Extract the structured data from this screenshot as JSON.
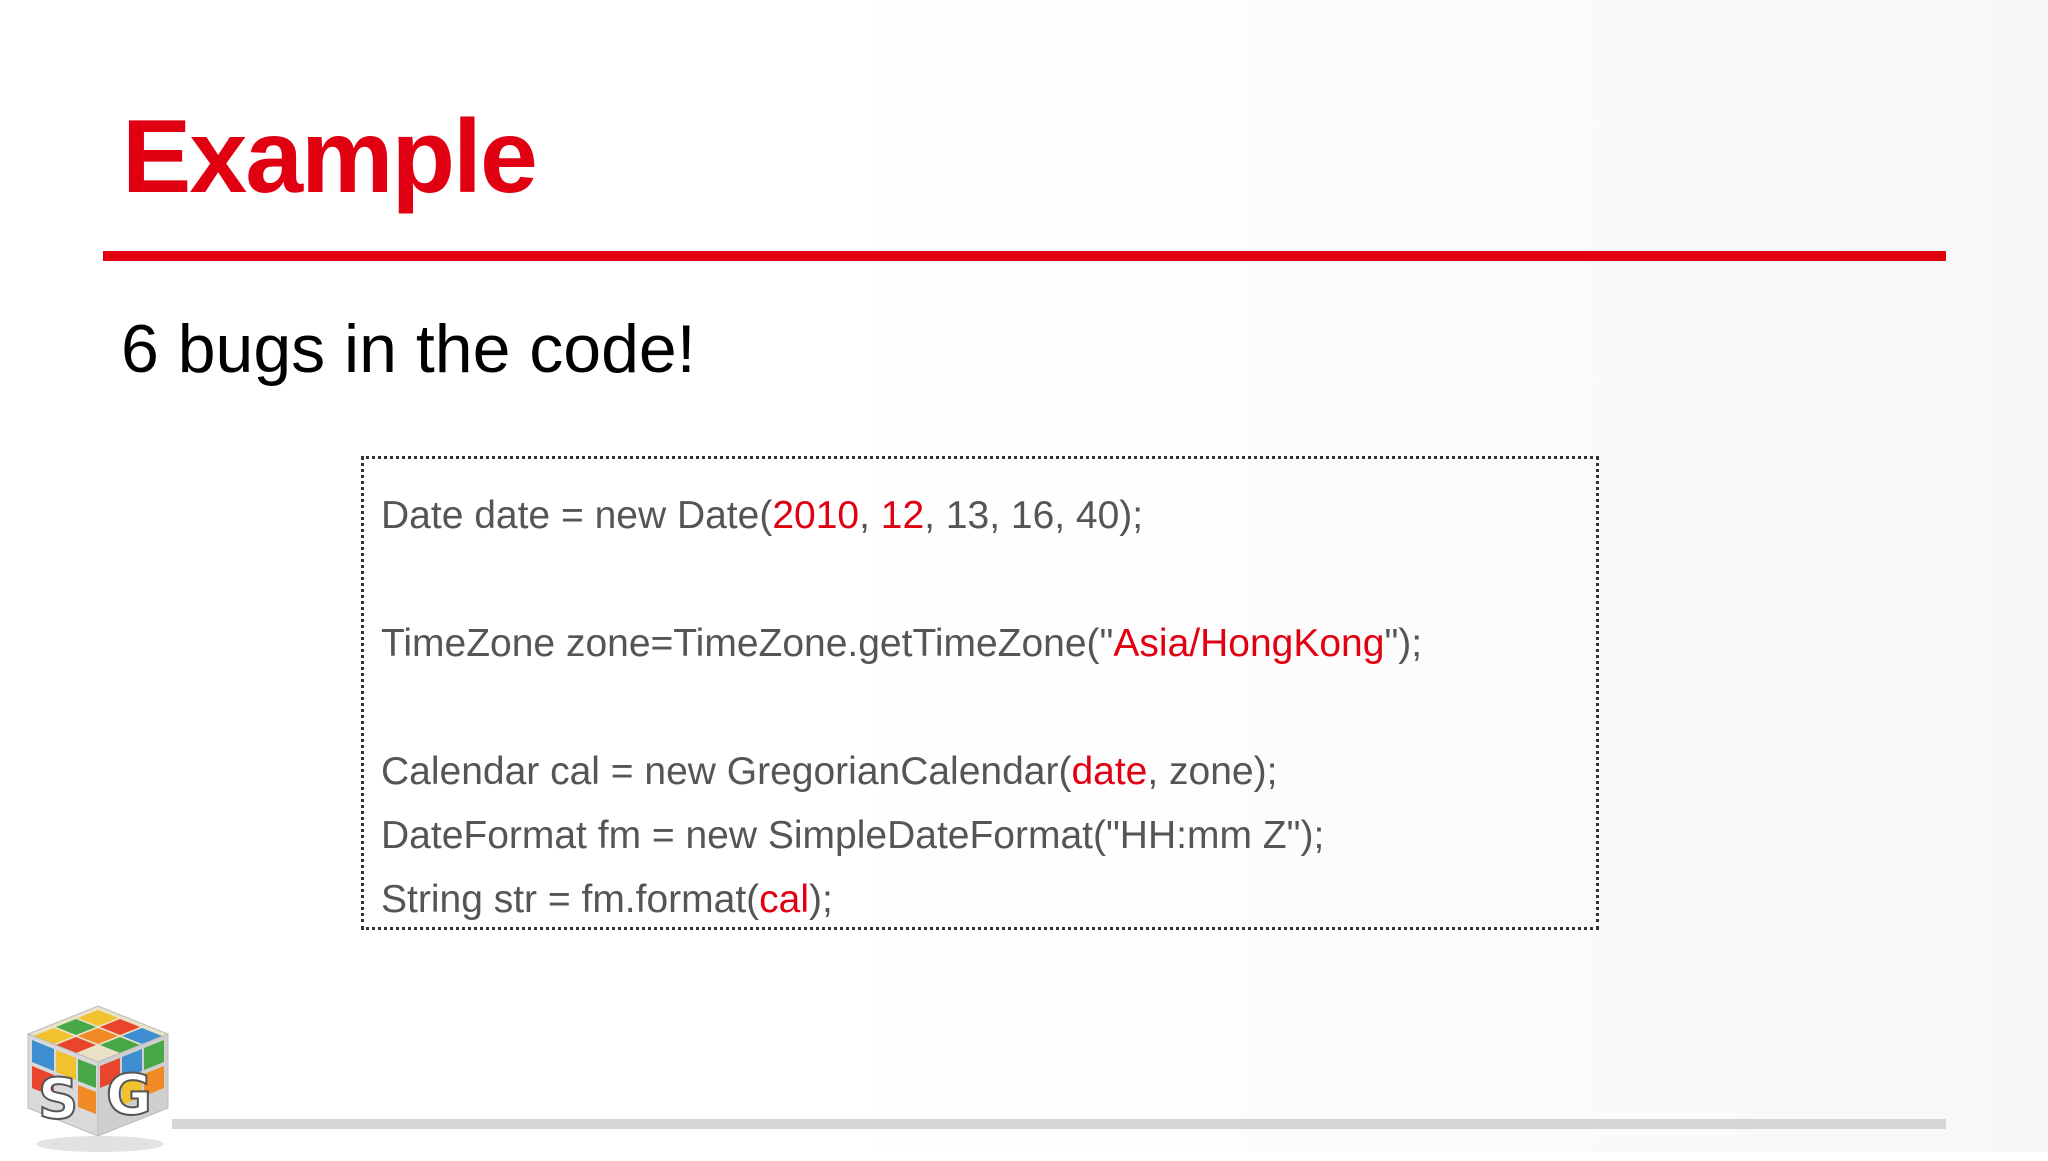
{
  "slide": {
    "title": "Example",
    "subtitle": "6 bugs in the code!"
  },
  "code": {
    "line1": {
      "pre": "Date date = new Date(",
      "bug1": "2010",
      "sep1": ", ",
      "bug2": "12",
      "post": ", 13, 16, 40);"
    },
    "line2": {
      "pre": "TimeZone zone=TimeZone.getTimeZone(\"",
      "bug": "Asia/HongKong",
      "post": "\");"
    },
    "line3": {
      "pre": "Calendar cal = new GregorianCalendar(",
      "bug": "date",
      "post": ", zone);"
    },
    "line4": {
      "text": "DateFormat fm = new SimpleDateFormat(\"HH:mm Z\");"
    },
    "line5": {
      "pre": "String str = fm.format(",
      "bug": "cal",
      "post": ");"
    }
  },
  "colors": {
    "accent": "#e00012",
    "code_text": "#555555",
    "footer_rule": "#d4d6d8"
  },
  "logo": {
    "icon": "rubiks-cube-logo-icon",
    "letters": "SG"
  }
}
